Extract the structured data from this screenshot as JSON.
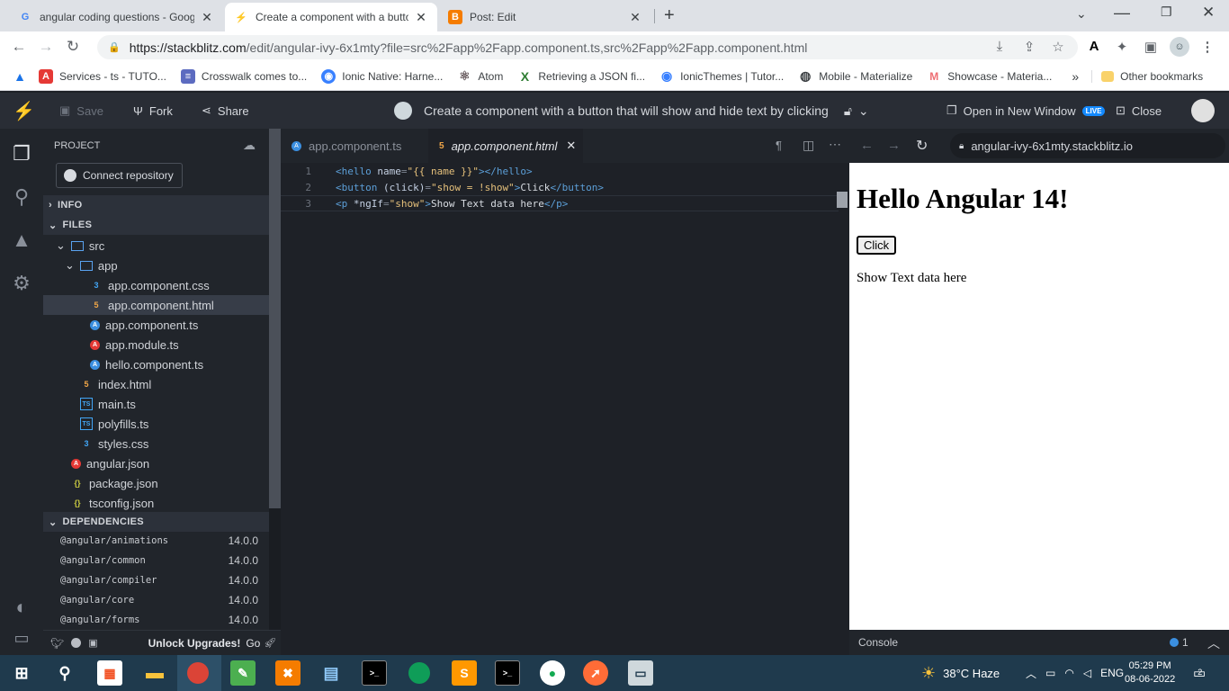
{
  "browser": {
    "tabs": [
      {
        "title": "angular coding questions - Goog",
        "favicon": "G",
        "color": "#4285f4"
      },
      {
        "title": "Create a component with a butto",
        "favicon": "⚡",
        "color": "#1389fd"
      },
      {
        "title": "Post: Edit",
        "favicon": "B",
        "color": "#f57c00"
      }
    ],
    "url_host": "https://stackblitz.com",
    "url_path": "/edit/angular-ivy-6x1mty?file=src%2Fapp%2Fapp.component.ts,src%2Fapp%2Fapp.component.html",
    "bookmarks": [
      {
        "label": "Services - ts - TUTO...",
        "icon": "A",
        "color": "#e53935"
      },
      {
        "label": "Crosswalk comes to...",
        "icon": "≡",
        "color": "#5c6bc0"
      },
      {
        "label": "Ionic Native: Harne...",
        "icon": "◉",
        "color": "#3880ff"
      },
      {
        "label": "Atom",
        "icon": "⚛",
        "color": "#66595c"
      },
      {
        "label": "Retrieving a JSON fi...",
        "icon": "X",
        "color": "#2e7d32"
      },
      {
        "label": "IonicThemes | Tutor...",
        "icon": "◉",
        "color": "#3880ff"
      },
      {
        "label": "Mobile - Materialize",
        "icon": "M",
        "color": "#ee6e73"
      },
      {
        "label": "Showcase - Materia...",
        "icon": "M",
        "color": "#ee6e73"
      }
    ],
    "bookmarks_more": "»",
    "other_bookmarks": "Other bookmarks"
  },
  "stackblitz": {
    "save": "Save",
    "fork": "Fork",
    "share": "Share",
    "project_title": "Create a component with a button that will show and hide text by clicking",
    "open_new_window": "Open in New Window",
    "live_badge": "LIVE",
    "close": "Close"
  },
  "sidebar": {
    "project_label": "PROJECT",
    "connect_repo": "Connect repository",
    "info": "INFO",
    "files": "FILES",
    "dependencies": "DEPENDENCIES",
    "tree": [
      {
        "name": "src",
        "type": "folder"
      },
      {
        "name": "app",
        "type": "folder"
      },
      {
        "name": "app.component.css",
        "type": "css"
      },
      {
        "name": "app.component.html",
        "type": "html"
      },
      {
        "name": "app.component.ts",
        "type": "ngts"
      },
      {
        "name": "app.module.ts",
        "type": "ngmod"
      },
      {
        "name": "hello.component.ts",
        "type": "ngts"
      },
      {
        "name": "index.html",
        "type": "html"
      },
      {
        "name": "main.ts",
        "type": "ts"
      },
      {
        "name": "polyfills.ts",
        "type": "ts"
      },
      {
        "name": "styles.css",
        "type": "css"
      },
      {
        "name": "angular.json",
        "type": "ngmod"
      },
      {
        "name": "package.json",
        "type": "json"
      },
      {
        "name": "tsconfig.json",
        "type": "json"
      }
    ],
    "deps": [
      {
        "name": "@angular/animations",
        "version": "14.0.0"
      },
      {
        "name": "@angular/common",
        "version": "14.0.0"
      },
      {
        "name": "@angular/compiler",
        "version": "14.0.0"
      },
      {
        "name": "@angular/core",
        "version": "14.0.0"
      },
      {
        "name": "@angular/forms",
        "version": "14.0.0"
      }
    ],
    "unlock": "Unlock Upgrades!",
    "go": "Go"
  },
  "editor": {
    "tabs": [
      {
        "label": "app.component.ts"
      },
      {
        "label": "app.component.html"
      }
    ],
    "lines": [
      "1",
      "2",
      "3"
    ],
    "code": {
      "l1": {
        "t1": "<hello",
        "a1": " name",
        "e1": "=",
        "v1": "\"{{ name }}\"",
        "t2": "></hello>"
      },
      "l2": {
        "t1": "<button",
        "a1": " (click)",
        "e1": "=",
        "v1": "\"show = !show\"",
        "t2": ">",
        "tx": "Click",
        "t3": "</button>"
      },
      "l3": {
        "t1": "<p",
        "a1": " *ngIf",
        "e1": "=",
        "v1": "\"show\"",
        "t2": ">",
        "tx": "Show Text data here",
        "t3": "</p>"
      }
    }
  },
  "preview": {
    "url": "angular-ivy-6x1mty.stackblitz.io",
    "heading": "Hello Angular 14!",
    "button": "Click",
    "text": "Show Text data here",
    "console": "Console",
    "console_count": "1"
  },
  "taskbar": {
    "weather": "38°C  Haze",
    "lang": "ENG",
    "time": "05:29 PM",
    "date": "08-06-2022",
    "notif": "2"
  }
}
